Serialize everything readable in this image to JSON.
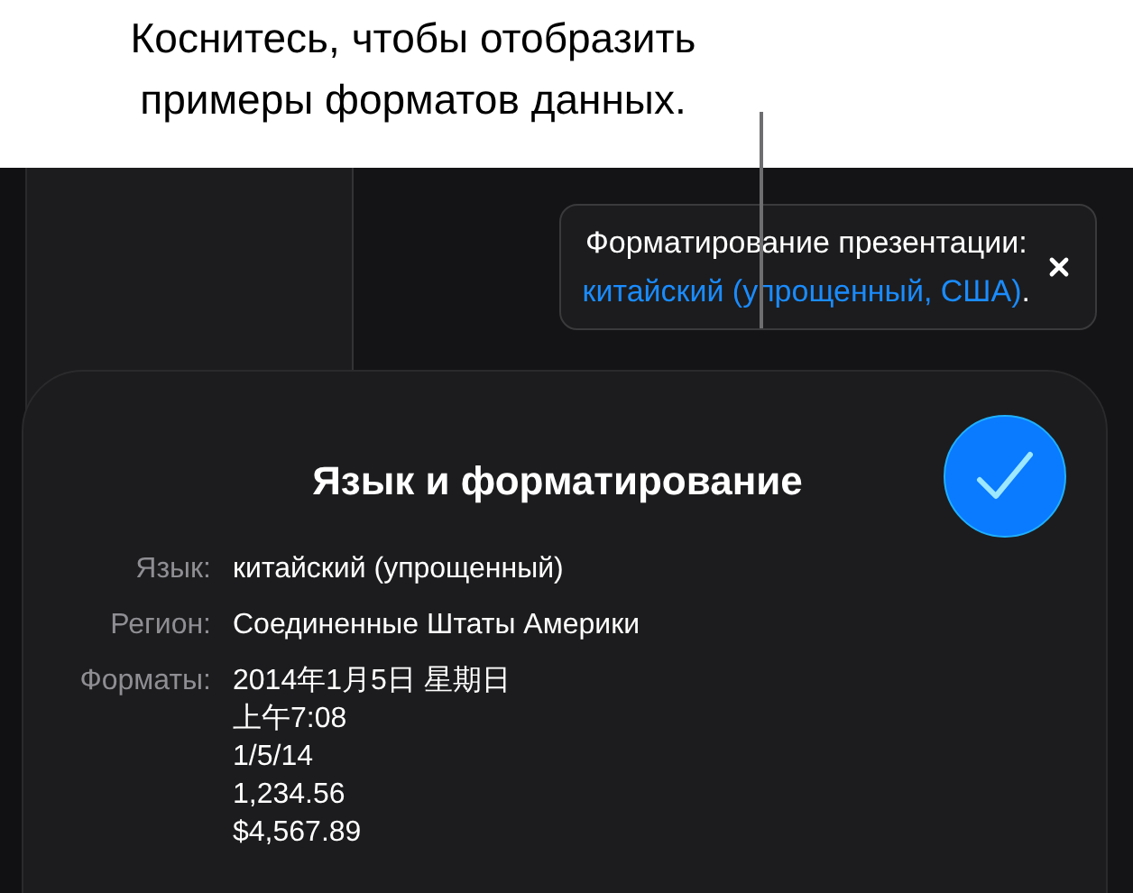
{
  "callout": {
    "lines": [
      "Коснитесь, чтобы отобразить",
      "примеры форматов данных."
    ]
  },
  "banner": {
    "text": "Форматирование презентации:",
    "link": "китайский (упрощенный, США)",
    "suffix": "."
  },
  "card": {
    "title": "Язык и форматирование",
    "rows": [
      {
        "label": "Язык:",
        "values": [
          "китайский (упрощенный)"
        ]
      },
      {
        "label": "Регион:",
        "values": [
          "Соединенные Штаты Америки"
        ]
      },
      {
        "label": "Форматы:",
        "values": [
          "2014年1月5日 星期日",
          "上午7:08",
          "1/5/14",
          "1,234.56",
          "$4,567.89"
        ]
      }
    ]
  }
}
